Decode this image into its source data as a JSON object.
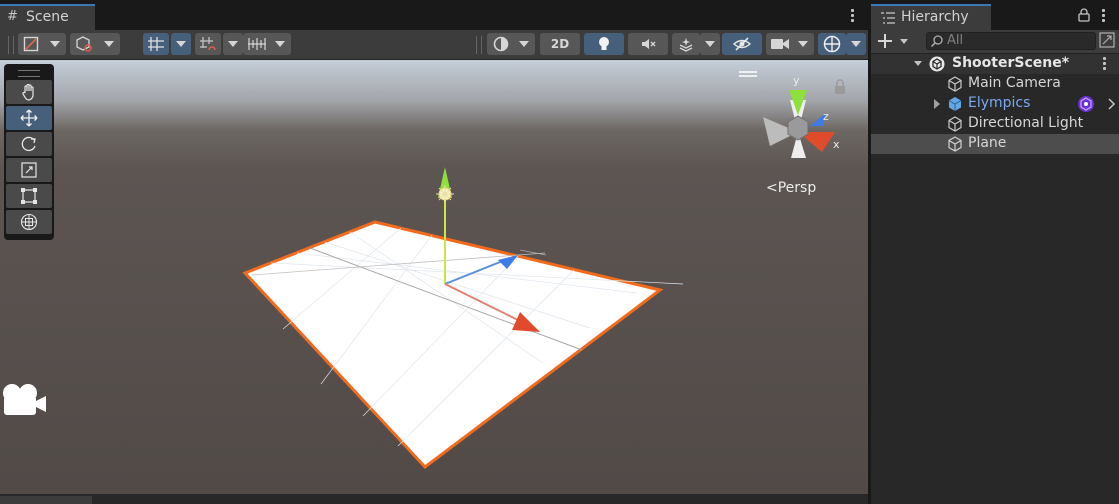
{
  "scene": {
    "tab_title": "Scene",
    "toolbar": {
      "view_2d_label": "2D"
    },
    "camera_mode": "Persp",
    "gizmo_axes": {
      "x": "x",
      "y": "y",
      "z": "z"
    },
    "tools": [
      "hand-tool",
      "move-tool",
      "rotate-tool",
      "scale-tool",
      "rect-tool",
      "transform-tool"
    ],
    "active_tool": "move-tool"
  },
  "hierarchy": {
    "tab_title": "Hierarchy",
    "search_placeholder": "All",
    "scene_name": "ShooterScene*",
    "items": [
      {
        "label": "Main Camera",
        "color": "#d6d6d6"
      },
      {
        "label": "Elympics",
        "color": "#7aa9f2"
      },
      {
        "label": "Directional Light",
        "color": "#d6d6d6"
      },
      {
        "label": "Plane",
        "color": "#d6d6d6"
      }
    ]
  },
  "colors": {
    "accent": "#3a79bb",
    "active_button": "#46607c",
    "selection_outline": "#f26b1d",
    "axis_x": "#e04b2c",
    "axis_y": "#8fe03c",
    "axis_z": "#3f7be8"
  }
}
